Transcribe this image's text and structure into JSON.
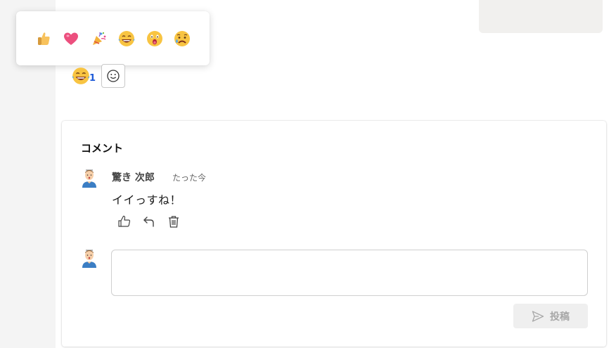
{
  "reaction_picker": {
    "options": [
      {
        "icon": "thumbs-up-emoji"
      },
      {
        "icon": "heart-emoji"
      },
      {
        "icon": "party-popper-emoji"
      },
      {
        "icon": "laughing-tears-emoji"
      },
      {
        "icon": "surprised-emoji"
      },
      {
        "icon": "sad-tear-emoji"
      }
    ]
  },
  "reactions": {
    "current": {
      "icon": "laughing-tears-emoji",
      "count": "1"
    },
    "add_icon": "smiley-add-icon"
  },
  "comments_section": {
    "heading": "コメント",
    "items": [
      {
        "author": "驚き 次郎",
        "time": "たった今",
        "body": "イイっすね！",
        "avatar_icon": "avatar"
      }
    ],
    "actions": [
      "like-icon",
      "reply-icon",
      "delete-icon"
    ]
  },
  "composer": {
    "input_value": "",
    "input_placeholder": "",
    "post_label": "投稿"
  },
  "colors": {
    "accent_blue": "#1e5bd8",
    "disabled_button_bg": "#efefef",
    "disabled_button_text": "#a8a8a8"
  }
}
